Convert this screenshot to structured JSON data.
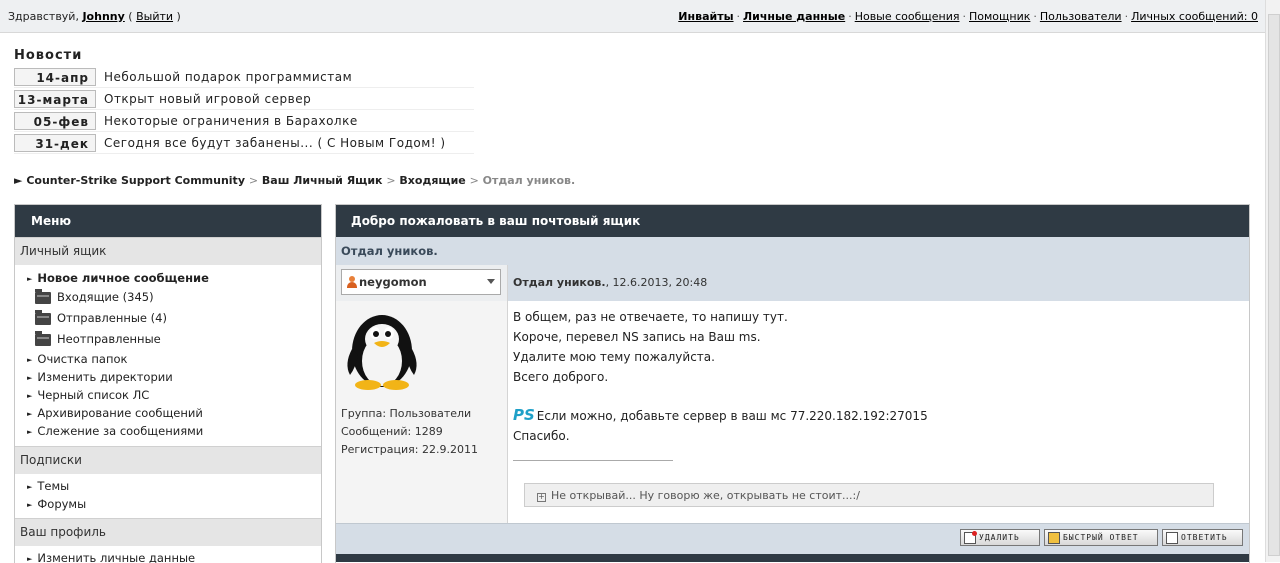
{
  "topbar": {
    "greeting": "Здравствуй,",
    "username": "Johnny",
    "logout_open": "(",
    "logout": "Выйти",
    "logout_close": ")",
    "links": {
      "invites": "Инвайты",
      "personal_data": "Личные данные",
      "new_messages": "Новые сообщения",
      "helper": "Помощник",
      "users": "Пользователи",
      "pm": "Личных сообщений: 0"
    }
  },
  "news": {
    "title": "Новости",
    "items": [
      {
        "date": "14-апр",
        "text": "Небольшой подарок программистам"
      },
      {
        "date": "13-марта",
        "text": "Открыт новый игровой сервер"
      },
      {
        "date": "05-фев",
        "text": "Некоторые ограничения в Барахолке"
      },
      {
        "date": "31-дек",
        "text": "Сегодня все будут забанены... ( С Новым Годом! )"
      }
    ]
  },
  "breadcrumb": {
    "arrow": "►",
    "items": [
      "Counter-Strike Support Community",
      "Ваш Личный Ящик",
      "Входящие"
    ],
    "sep": ">",
    "current": "Отдал уников."
  },
  "menu": {
    "title": "Меню",
    "section_mailbox": "Личный ящик",
    "new_pm": "Новое личное сообщение",
    "folders": [
      "Входящие (345)",
      "Отправленные (4)",
      "Неотправленные"
    ],
    "mailbox_items": [
      "Очистка папок",
      "Изменить директории",
      "Черный список ЛС",
      "Архивирование сообщений",
      "Слежение за сообщениями"
    ],
    "section_subscriptions": "Подписки",
    "subscription_items": [
      "Темы",
      "Форумы"
    ],
    "section_profile": "Ваш профиль",
    "profile_items": [
      "Изменить личные данные"
    ]
  },
  "main": {
    "title": "Добро пожаловать в ваш почтовый ящик",
    "subject": "Отдал уников.",
    "author": "neygomon",
    "post_title": "Отдал уников.",
    "post_date": ", 12.6.2013, 20:48",
    "author_meta": [
      "Группа: Пользователи",
      "Сообщений: 1289",
      "Регистрация: 22.9.2011"
    ],
    "message_lines": [
      "В общем, раз не отвечаете, то напишу тут.",
      "Короче, перевел NS запись на Ваш ms.",
      "Удалите мою тему пожалуйста.",
      "Всего доброго."
    ],
    "ps_label": "PS",
    "ps_text": "Если можно, добавьте сервер в ваш мс 77.220.182.192:27015",
    "thanks": "Спасибо.",
    "spoiler": "Не открывай... Ну говорю же, открывать не стоит...:/",
    "buttons": {
      "delete": "УДАЛИТЬ",
      "quick_reply": "БЫСТРЫЙ ОТВЕТ",
      "reply": "ОТВЕТИТЬ"
    }
  }
}
